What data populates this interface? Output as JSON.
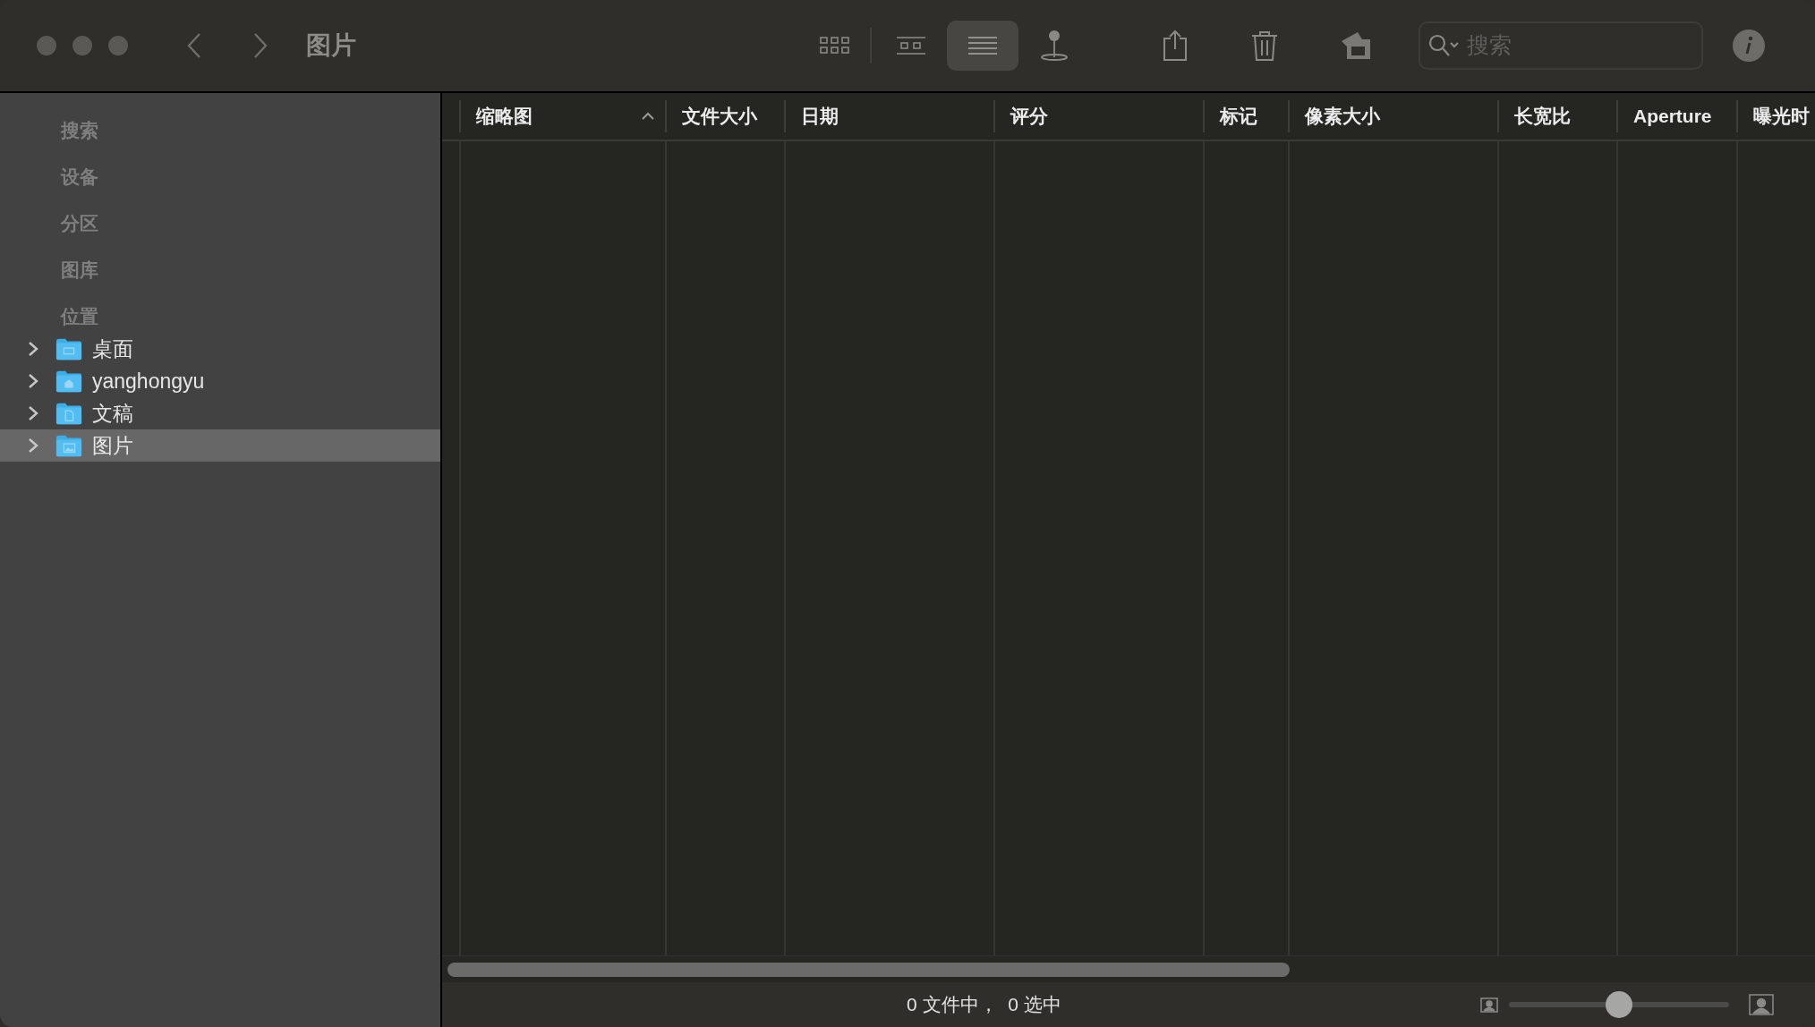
{
  "window": {
    "title": "图片"
  },
  "toolbar": {
    "views": [
      {
        "kind": "icons",
        "selected": false
      },
      {
        "kind": "gallery",
        "selected": false
      },
      {
        "kind": "list",
        "selected": true
      },
      {
        "kind": "pin",
        "selected": false
      }
    ],
    "search": {
      "placeholder": "搜索"
    }
  },
  "sidebar": {
    "sections": [
      {
        "label": "搜索"
      },
      {
        "label": "设备"
      },
      {
        "label": "分区"
      },
      {
        "label": "图库"
      },
      {
        "label": "位置",
        "items": [
          {
            "label": "桌面",
            "kind": "desktop",
            "selected": false
          },
          {
            "label": "yanghongyu",
            "kind": "home",
            "selected": false
          },
          {
            "label": "文稿",
            "kind": "document",
            "selected": false
          },
          {
            "label": "图片",
            "kind": "picture",
            "selected": true
          }
        ]
      }
    ]
  },
  "table": {
    "columns": [
      {
        "label": "缩略图",
        "sorted": true
      },
      {
        "label": "文件大小",
        "sorted": false
      },
      {
        "label": "日期",
        "sorted": false
      },
      {
        "label": "评分",
        "sorted": false
      },
      {
        "label": "标记",
        "sorted": false
      },
      {
        "label": "像素大小",
        "sorted": false
      },
      {
        "label": "长宽比",
        "sorted": false
      },
      {
        "label": "Aperture",
        "sorted": false
      },
      {
        "label": "曝光时",
        "sorted": false
      }
    ]
  },
  "status_bar": {
    "text": "0 文件中，  0 选中",
    "zoom": {
      "level": 0.5
    }
  }
}
